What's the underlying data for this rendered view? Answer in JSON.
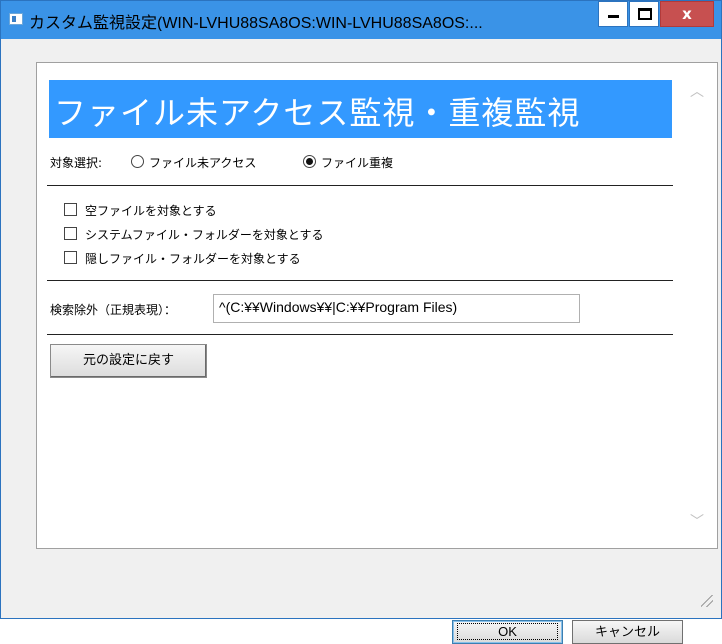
{
  "window": {
    "title": "カスタム監視設定(WIN-LVHU88SA8OS:WIN-LVHU88SA8OS:...",
    "close_label": "x"
  },
  "header": {
    "title": "ファイル未アクセス監視・重複監視"
  },
  "target_selection": {
    "label": "対象選択:",
    "options": [
      {
        "label": "ファイル未アクセス",
        "selected": false
      },
      {
        "label": "ファイル重複",
        "selected": true
      }
    ]
  },
  "checkboxes": [
    {
      "label": "空ファイルを対象とする",
      "checked": false
    },
    {
      "label": "システムファイル・フォルダーを対象とする",
      "checked": false
    },
    {
      "label": "隠しファイル・フォルダーを対象とする",
      "checked": false
    }
  ],
  "exclusion": {
    "label": "検索除外（正規表現）：",
    "value": "^(C:¥¥Windows¥¥|C:¥¥Program Files)"
  },
  "buttons": {
    "reset": "元の設定に戻す",
    "ok": "OK",
    "cancel": "キャンセル"
  },
  "colors": {
    "banner": "#3399ff",
    "titlebar": "#3a93e7",
    "close": "#c75050"
  }
}
